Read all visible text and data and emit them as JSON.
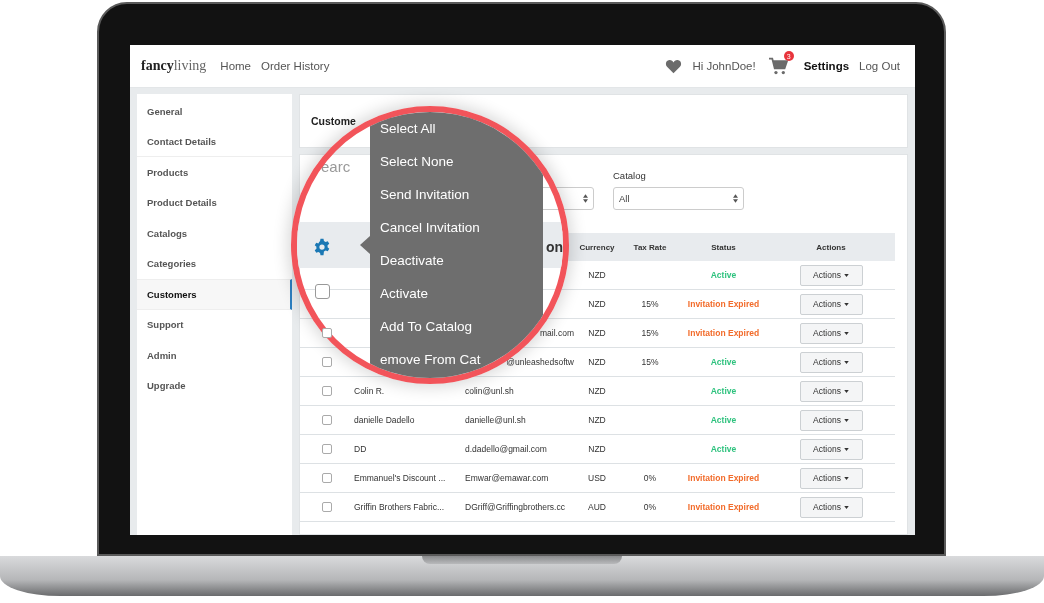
{
  "header": {
    "logo": {
      "bold": "fancy",
      "light": "living"
    },
    "nav": [
      "Home",
      "Order History"
    ],
    "greeting": "Hi JohnDoe!",
    "cart_count": "3",
    "settings": "Settings",
    "logout": "Log Out"
  },
  "sidebar": {
    "items": [
      {
        "label": "General",
        "selected": false,
        "divider": false
      },
      {
        "label": "Contact Details",
        "selected": false,
        "divider": true
      },
      {
        "label": "Products",
        "selected": false,
        "divider": false
      },
      {
        "label": "Product Details",
        "selected": false,
        "divider": false
      },
      {
        "label": "Catalogs",
        "selected": false,
        "divider": false
      },
      {
        "label": "Categories",
        "selected": false,
        "divider": false
      },
      {
        "label": "Customers",
        "selected": true,
        "divider": false
      },
      {
        "label": "Support",
        "selected": false,
        "divider": false
      },
      {
        "label": "Admin",
        "selected": false,
        "divider": false
      },
      {
        "label": "Upgrade",
        "selected": false,
        "divider": false
      }
    ]
  },
  "title": "Custome",
  "search": {
    "placeholder": "earc"
  },
  "filter": {
    "label": "Catalog",
    "value": "All"
  },
  "table": {
    "columns": [
      "Currency",
      "Tax Rate",
      "Status",
      "Actions"
    ],
    "rows": [
      {
        "currency": "NZD",
        "status": "Active",
        "color": "#2ec27e",
        "action": "Actions"
      },
      {
        "currency": "NZD",
        "tax": "15%",
        "status": "Invitation Expired",
        "color": "#f26b2a",
        "action": "Actions"
      },
      {
        "checked": false,
        "email": "mail.com",
        "covered": true,
        "currency": "NZD",
        "tax": "15%",
        "status": "Invitation Expired",
        "color": "#f26b2a",
        "action": "Actions"
      },
      {
        "checked": false,
        "email": "@unleashedsoftw",
        "covered": true,
        "currency": "NZD",
        "tax": "15%",
        "status": "Active",
        "color": "#2ec27e",
        "action": "Actions"
      },
      {
        "checked": false,
        "name": "Colin R.",
        "email": "colin@unl.sh",
        "covered": false,
        "currency": "NZD",
        "status": "Active",
        "color": "#2ec27e",
        "action": "Actions"
      },
      {
        "checked": false,
        "name": "danielle Dadello",
        "email": "danielle@unl.sh",
        "covered": false,
        "currency": "NZD",
        "status": "Active",
        "color": "#2ec27e",
        "action": "Actions"
      },
      {
        "checked": false,
        "name": "DD",
        "email": "d.dadello@gmail.com",
        "covered": false,
        "currency": "NZD",
        "status": "Active",
        "color": "#2ec27e",
        "action": "Actions"
      },
      {
        "checked": false,
        "name": "Emmanuel's Discount ...",
        "email": "Emwar@emawar.com",
        "covered": false,
        "currency": "USD",
        "tax": "0%",
        "status": "Invitation Expired",
        "color": "#f26b2a",
        "action": "Actions"
      },
      {
        "checked": false,
        "name": "Griffin Brothers Fabric...",
        "email": "DGriff@Griffingbrothers.cc",
        "covered": false,
        "currency": "AUD",
        "tax": "0%",
        "status": "Invitation Expired",
        "color": "#f26b2a",
        "action": "Actions"
      }
    ]
  },
  "magnifier": {
    "column_fragment": "on",
    "header_checked": false,
    "menu": [
      "Select All",
      "Select None",
      "Send Invitation",
      "Cancel Invitation",
      "Deactivate",
      "Activate",
      "Add To Catalog",
      "emove From Cat"
    ]
  }
}
